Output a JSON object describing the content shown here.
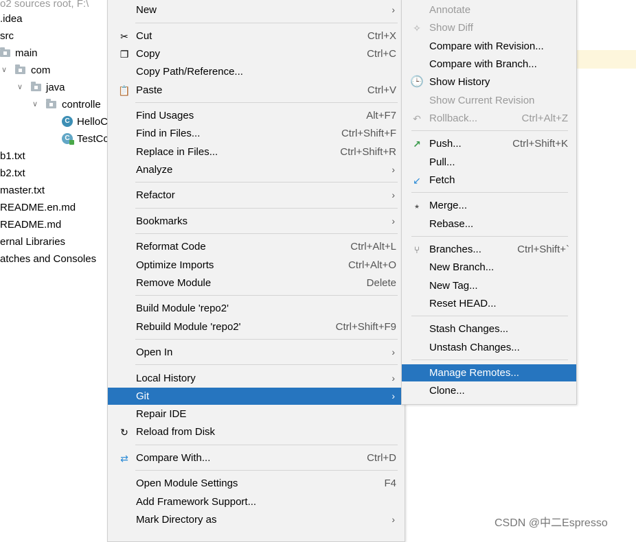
{
  "tree": {
    "header": "o2  sources root,  F:\\",
    "items": [
      {
        "label": ".idea",
        "kind": "text"
      },
      {
        "label": "src",
        "kind": "text"
      },
      {
        "label": "main",
        "kind": "folder"
      },
      {
        "label": "com",
        "kind": "folder"
      },
      {
        "label": "java",
        "kind": "folder"
      },
      {
        "label": "controlle",
        "kind": "folder"
      },
      {
        "label": "HelloC",
        "kind": "class"
      },
      {
        "label": "TestCo",
        "kind": "class-run"
      },
      {
        "label": "b1.txt",
        "kind": "text"
      },
      {
        "label": "b2.txt",
        "kind": "text"
      },
      {
        "label": "master.txt",
        "kind": "text"
      },
      {
        "label": "README.en.md",
        "kind": "text"
      },
      {
        "label": "README.md",
        "kind": "text"
      },
      {
        "label": "ernal Libraries",
        "kind": "text"
      },
      {
        "label": "atches and Consoles",
        "kind": "text"
      }
    ]
  },
  "context_menu": {
    "items": [
      {
        "label": "New",
        "submenu": true
      },
      {
        "label": "Cut",
        "shortcut": "Ctrl+X",
        "icon": "scissors-icon"
      },
      {
        "label": "Copy",
        "shortcut": "Ctrl+C",
        "icon": "copy-icon"
      },
      {
        "label": "Copy Path/Reference..."
      },
      {
        "label": "Paste",
        "shortcut": "Ctrl+V",
        "icon": "clipboard-icon"
      },
      {
        "label": "Find Usages",
        "shortcut": "Alt+F7"
      },
      {
        "label": "Find in Files...",
        "shortcut": "Ctrl+Shift+F"
      },
      {
        "label": "Replace in Files...",
        "shortcut": "Ctrl+Shift+R"
      },
      {
        "label": "Analyze",
        "submenu": true
      },
      {
        "label": "Refactor",
        "submenu": true
      },
      {
        "label": "Bookmarks",
        "submenu": true
      },
      {
        "label": "Reformat Code",
        "shortcut": "Ctrl+Alt+L"
      },
      {
        "label": "Optimize Imports",
        "shortcut": "Ctrl+Alt+O"
      },
      {
        "label": "Remove Module",
        "shortcut": "Delete"
      },
      {
        "label": "Build Module 'repo2'"
      },
      {
        "label": "Rebuild Module 'repo2'",
        "shortcut": "Ctrl+Shift+F9"
      },
      {
        "label": "Open In",
        "submenu": true
      },
      {
        "label": "Local History",
        "submenu": true
      },
      {
        "label": "Git",
        "submenu": true,
        "selected": true
      },
      {
        "label": "Repair IDE"
      },
      {
        "label": "Reload from Disk",
        "icon": "reload-icon"
      },
      {
        "label": "Compare With...",
        "shortcut": "Ctrl+D",
        "icon": "compare-arrows-icon"
      },
      {
        "label": "Open Module Settings",
        "shortcut": "F4"
      },
      {
        "label": "Add Framework Support..."
      },
      {
        "label": "Mark Directory as",
        "submenu": true
      }
    ]
  },
  "git_menu": {
    "items": [
      {
        "label": "Annotate",
        "disabled": true
      },
      {
        "label": "Show Diff",
        "disabled": true,
        "icon": "diff-icon"
      },
      {
        "label": "Compare with Revision..."
      },
      {
        "label": "Compare with Branch..."
      },
      {
        "label": "Show History",
        "icon": "clock-icon"
      },
      {
        "label": "Show Current Revision",
        "disabled": true
      },
      {
        "label": "Rollback...",
        "shortcut": "Ctrl+Alt+Z",
        "disabled": true,
        "icon": "rollback-icon"
      },
      {
        "label": "Push...",
        "shortcut": "Ctrl+Shift+K",
        "icon": "push-arrow-icon"
      },
      {
        "label": "Pull..."
      },
      {
        "label": "Fetch",
        "icon": "fetch-arrow-icon"
      },
      {
        "label": "Merge...",
        "icon": "merge-icon"
      },
      {
        "label": "Rebase..."
      },
      {
        "label": "Branches...",
        "shortcut": "Ctrl+Shift+`",
        "icon": "branch-icon"
      },
      {
        "label": "New Branch..."
      },
      {
        "label": "New Tag..."
      },
      {
        "label": "Reset HEAD..."
      },
      {
        "label": "Stash Changes..."
      },
      {
        "label": "Unstash Changes..."
      },
      {
        "label": "Manage Remotes...",
        "selected": true
      },
      {
        "label": "Clone..."
      }
    ]
  },
  "watermark": "CSDN @中二Espresso",
  "colors": {
    "selection": "#2675bf",
    "menu_bg": "#f2f2f2",
    "disabled": "#9a9a9a"
  }
}
